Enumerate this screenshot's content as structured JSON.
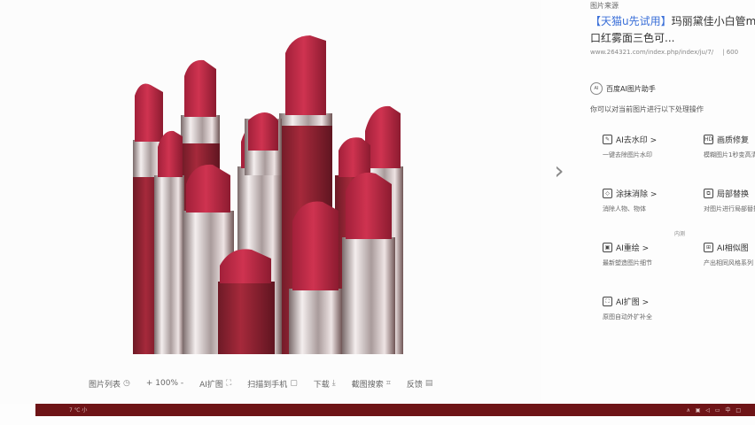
{
  "viewer": {
    "toolbar": [
      {
        "label": "图片列表",
        "icon": "list-icon"
      },
      {
        "label": "+  100%  -",
        "icon": "zoom-icon"
      },
      {
        "label": "AI扩图",
        "icon": "ai-expand-icon"
      },
      {
        "label": "扫描到手机",
        "icon": "qr-icon"
      },
      {
        "label": "下载",
        "icon": "download-icon"
      },
      {
        "label": "截图搜索",
        "icon": "screenshot-icon"
      },
      {
        "label": "反馈",
        "icon": "feedback-icon"
      }
    ],
    "next_icon": "chevron-right-icon"
  },
  "panel": {
    "source_label": "图片来源",
    "source_tag": "【天猫u先试用】",
    "source_title": "玛丽黛佳小白管m口红雾面三色可...",
    "source_url": "www.264321.com/index.php/index/ju/7/",
    "source_size": "| 600",
    "assistant_badge": "AI",
    "assistant_title": "百度AI图片助手",
    "assistant_desc": "你可以对当前图片进行以下处理操作",
    "internal_tag": "内测",
    "tools": [
      {
        "title": "AI去水印 >",
        "desc": "一键去除图片水印",
        "icon": "brush-icon"
      },
      {
        "title": "画质修复",
        "desc": "模糊图片1秒变高清",
        "icon": "hd-icon"
      },
      {
        "title": "涂抹消除 >",
        "desc": "消除人物、物体",
        "icon": "eraser-icon"
      },
      {
        "title": "局部替换",
        "desc": "对图片进行局部替换",
        "icon": "replace-icon"
      },
      {
        "title": "AI重绘 >",
        "desc": "最新塑造图片细节",
        "icon": "redraw-icon"
      },
      {
        "title": "AI相似图",
        "desc": "产出相同风格系列",
        "icon": "similar-icon"
      },
      {
        "title": "AI扩图 >",
        "desc": "原图自动外扩补全",
        "icon": "expand-icon"
      }
    ]
  },
  "taskbar": {
    "left_text": "7 ℃ 小",
    "right_text": "∧ ▣ ◁ ▭ 中 □"
  },
  "colors": {
    "lipstick": "#c3243f",
    "lipstick_dark": "#8e1c2c",
    "silver": "#d9d9d9",
    "taskbar": "#6e1417"
  }
}
